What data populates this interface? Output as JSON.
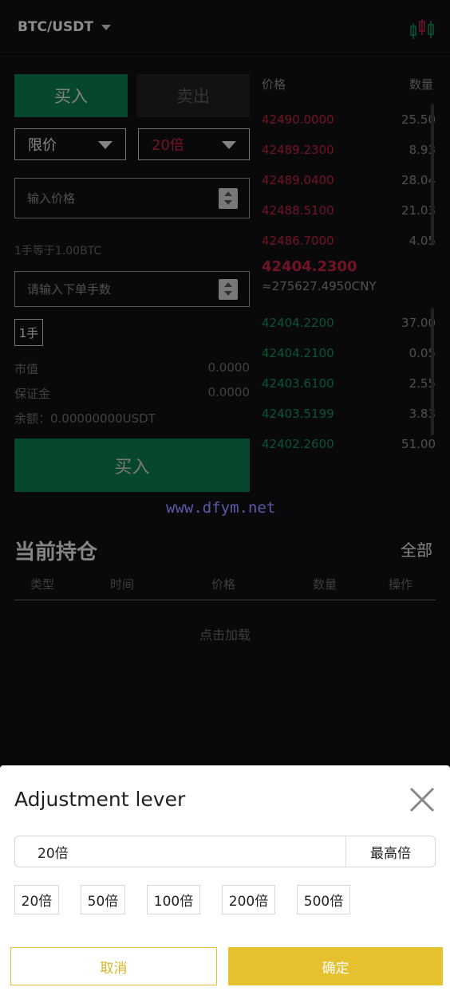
{
  "header": {
    "pair": "BTC/USDT"
  },
  "trade": {
    "buy_tab": "买入",
    "sell_tab": "卖出",
    "order_type": "限价",
    "leverage": "20倍",
    "price_placeholder": "输入价格",
    "lot_note": "1手等于1.00BTC",
    "qty_placeholder": "请输入下单手数",
    "lot_button": "1手",
    "market_value_label": "市值",
    "market_value": "0.0000",
    "margin_label": "保证金",
    "margin": "0.0000",
    "balance": "余额：0.00000000USDT",
    "buy_button": "买入"
  },
  "orderbook": {
    "price_header": "价格",
    "qty_header": "数量",
    "asks": [
      {
        "price": "42490.0000",
        "qty": "25.50"
      },
      {
        "price": "42489.2300",
        "qty": "8.93"
      },
      {
        "price": "42489.0400",
        "qty": "28.04"
      },
      {
        "price": "42488.5100",
        "qty": "21.03"
      },
      {
        "price": "42486.7000",
        "qty": "4.05"
      }
    ],
    "last_price": "42404.2300",
    "cny": "≈275627.4950CNY",
    "bids": [
      {
        "price": "42404.2200",
        "qty": "37.00"
      },
      {
        "price": "42404.2100",
        "qty": "0.05"
      },
      {
        "price": "42403.6100",
        "qty": "2.55"
      },
      {
        "price": "42403.5199",
        "qty": "3.83"
      },
      {
        "price": "42402.2600",
        "qty": "51.00"
      }
    ],
    "ask_color": "#c2243f",
    "bid_color": "#119160"
  },
  "watermark": "www.dfym.net",
  "positions": {
    "title": "当前持仓",
    "all": "全部",
    "columns": [
      "类型",
      "时间",
      "价格",
      "数量",
      "操作"
    ],
    "load_more": "点击加载"
  },
  "sheet": {
    "title": "Adjustment lever",
    "current_value": "20倍",
    "max_button": "最高倍",
    "options": [
      "20倍",
      "50倍",
      "100倍",
      "200倍",
      "500倍"
    ],
    "cancel": "取消",
    "confirm": "确定",
    "accent_color": "#e6c12f"
  }
}
